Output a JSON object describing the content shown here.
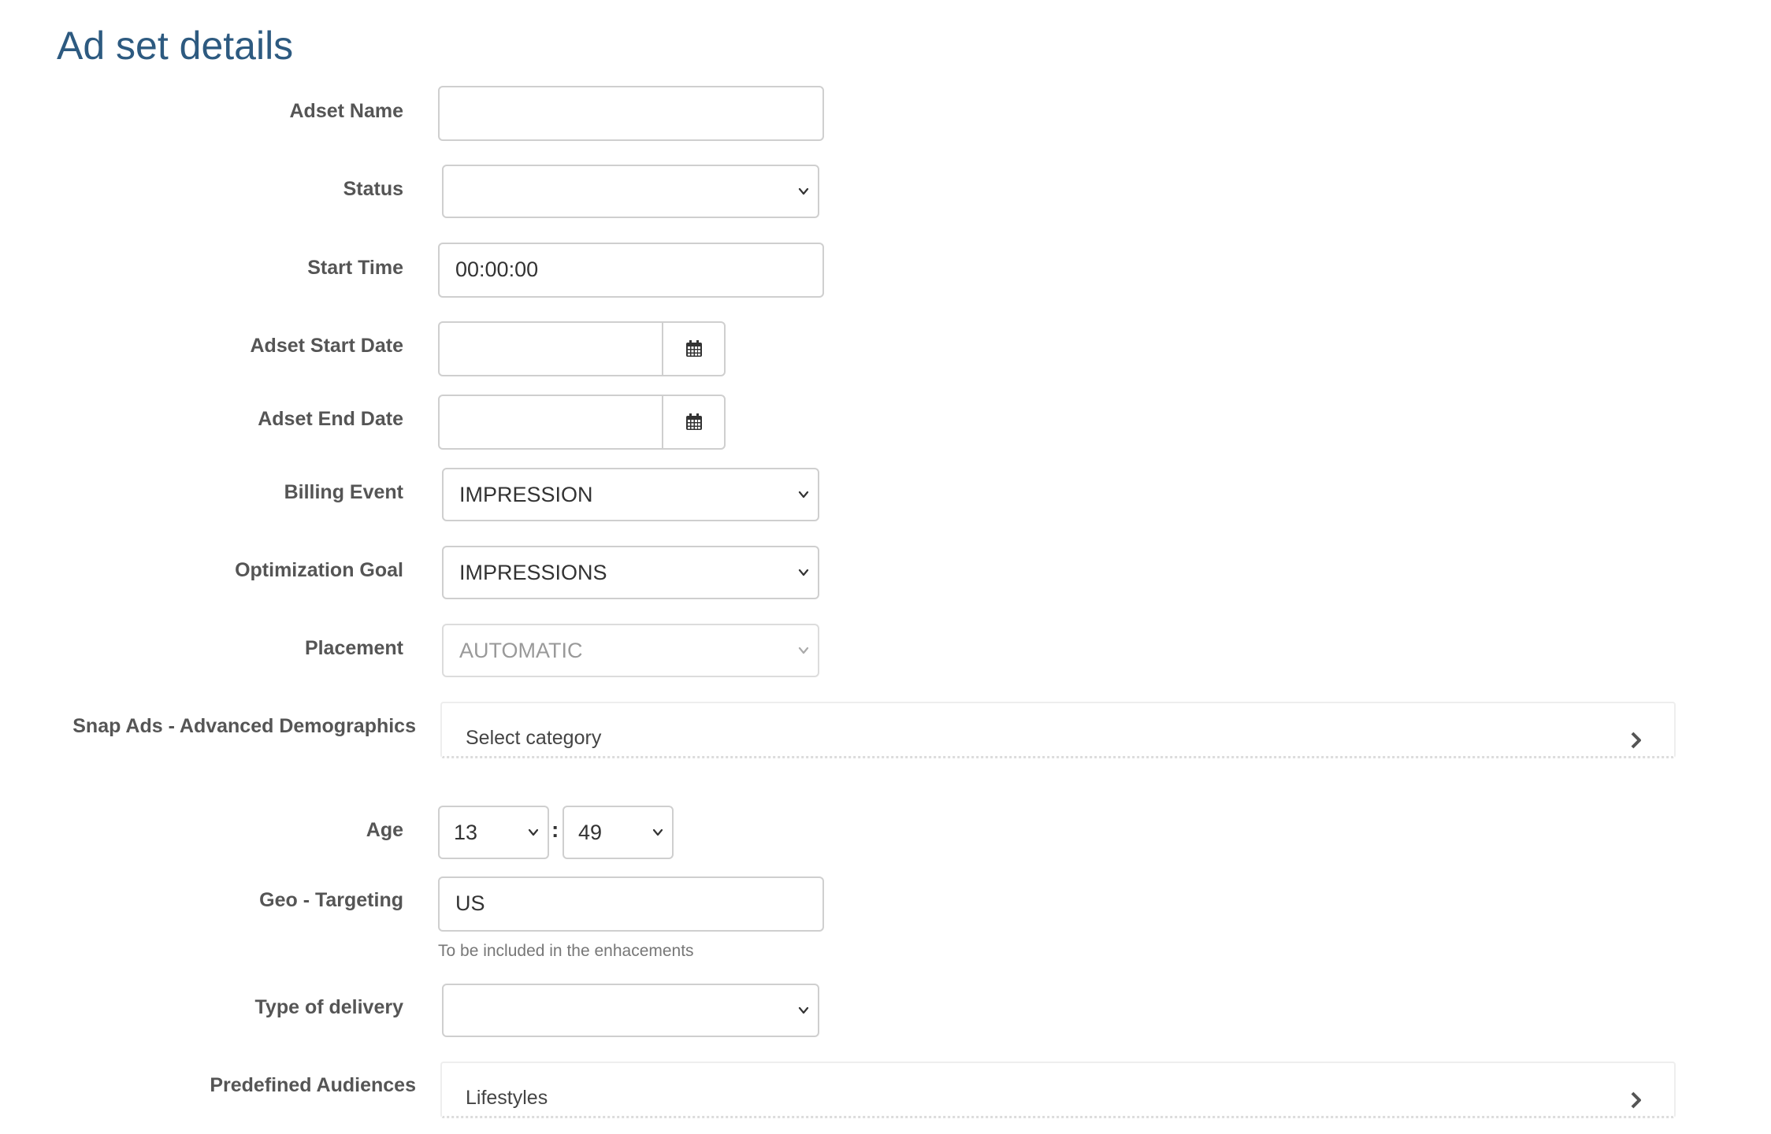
{
  "page": {
    "title": "Ad set details"
  },
  "form": {
    "adset_name": {
      "label": "Adset Name",
      "value": "",
      "placeholder": ""
    },
    "status": {
      "label": "Status",
      "value": ""
    },
    "start_time": {
      "label": "Start Time",
      "value": "00:00:00"
    },
    "adset_start_date": {
      "label": "Adset Start Date",
      "value": ""
    },
    "adset_end_date": {
      "label": "Adset End Date",
      "value": ""
    },
    "billing_event": {
      "label": "Billing Event",
      "value": "IMPRESSION"
    },
    "optimization_goal": {
      "label": "Optimization Goal",
      "value": "IMPRESSIONS"
    },
    "placement": {
      "label": "Placement",
      "value": "AUTOMATIC",
      "disabled": true
    },
    "demographics": {
      "label": "Snap Ads - Advanced Demographics",
      "selector_text": "Select category"
    },
    "age": {
      "label": "Age",
      "min": "13",
      "separator": ":",
      "max": "49"
    },
    "geo_targeting": {
      "label": "Geo - Targeting",
      "value": "US",
      "help": "To be included in the enhacements"
    },
    "type_of_delivery": {
      "label": "Type of delivery",
      "value": ""
    },
    "predefined_audiences": {
      "label": "Predefined Audiences",
      "selector_text": "Lifestyles"
    }
  },
  "icons": {
    "calendar": "calendar-icon",
    "dropdown": "chevron-down-icon",
    "expand": "chevron-right-icon"
  },
  "colors": {
    "title": "#2d5a80",
    "label": "#555555",
    "border": "#cfcfcf",
    "help": "#777777"
  }
}
